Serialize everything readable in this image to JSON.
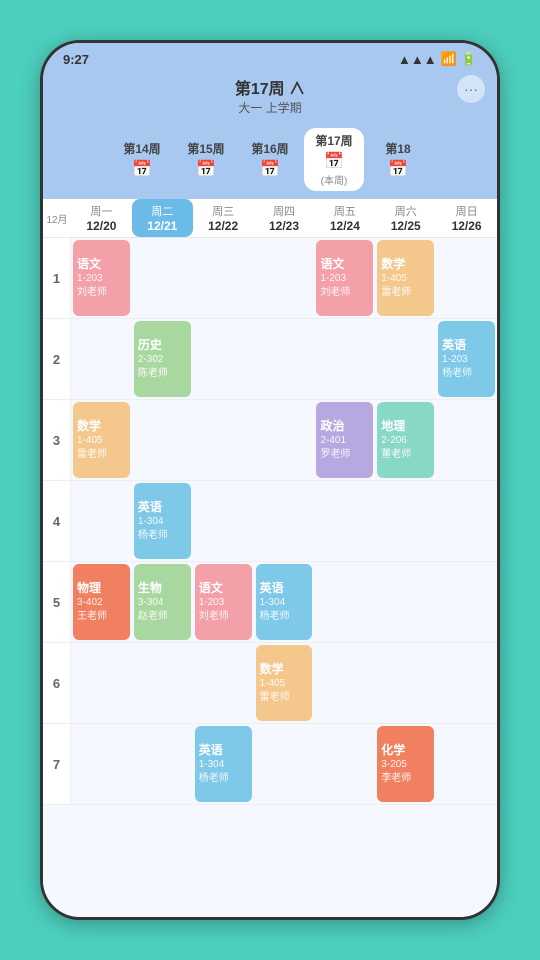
{
  "status": {
    "time": "9:27",
    "signal": "▲▲▲",
    "wifi": "WiFi",
    "battery": "■■"
  },
  "header": {
    "week_title": "第17周 ∧",
    "semester": "大一 上学期",
    "more_icon": "···"
  },
  "week_selector": [
    {
      "id": "w14",
      "label": "第14周",
      "active": false
    },
    {
      "id": "w15",
      "label": "第15周",
      "active": false
    },
    {
      "id": "w16",
      "label": "第16周",
      "active": false
    },
    {
      "id": "w17",
      "label": "第17周",
      "active": true,
      "current_label": "(本周)"
    },
    {
      "id": "w18",
      "label": "第18",
      "active": false
    }
  ],
  "days": [
    {
      "id": "mon",
      "name": "周一",
      "date": "12/20",
      "today": false
    },
    {
      "id": "tue",
      "name": "周二",
      "date": "12/21",
      "today": true
    },
    {
      "id": "wed",
      "name": "周三",
      "date": "12/22",
      "today": false
    },
    {
      "id": "thu",
      "name": "周四",
      "date": "12/23",
      "today": false
    },
    {
      "id": "fri",
      "name": "周五",
      "date": "12/24",
      "today": false
    },
    {
      "id": "sat",
      "name": "周六",
      "date": "12/25",
      "today": false
    },
    {
      "id": "sun",
      "name": "周日",
      "date": "12/26",
      "today": false
    }
  ],
  "month_label": "12月",
  "periods": [
    {
      "id": 1,
      "label": "1",
      "cells": [
        {
          "day": "mon",
          "course": "语文",
          "room": "1-203",
          "teacher": "刘老师",
          "color": "pink"
        },
        {
          "day": "tue",
          "course": "",
          "room": "",
          "teacher": "",
          "color": ""
        },
        {
          "day": "wed",
          "course": "",
          "room": "",
          "teacher": "",
          "color": ""
        },
        {
          "day": "thu",
          "course": "",
          "room": "",
          "teacher": "",
          "color": ""
        },
        {
          "day": "fri",
          "course": "语文",
          "room": "1-203",
          "teacher": "刘老师",
          "color": "pink"
        },
        {
          "day": "sat",
          "course": "数学",
          "room": "1-405",
          "teacher": "雷老师",
          "color": "orange"
        },
        {
          "day": "sun",
          "course": "",
          "room": "",
          "teacher": "",
          "color": ""
        }
      ]
    },
    {
      "id": 2,
      "label": "2",
      "cells": [
        {
          "day": "mon",
          "course": "",
          "room": "",
          "teacher": "",
          "color": ""
        },
        {
          "day": "tue",
          "course": "历史",
          "room": "2-302",
          "teacher": "陈老师",
          "color": "green"
        },
        {
          "day": "wed",
          "course": "",
          "room": "",
          "teacher": "",
          "color": ""
        },
        {
          "day": "thu",
          "course": "",
          "room": "",
          "teacher": "",
          "color": ""
        },
        {
          "day": "fri",
          "course": "",
          "room": "",
          "teacher": "",
          "color": ""
        },
        {
          "day": "sat",
          "course": "",
          "room": "",
          "teacher": "",
          "color": ""
        },
        {
          "day": "sun",
          "course": "英语",
          "room": "1-203",
          "teacher": "杨老师",
          "color": "blue"
        }
      ]
    },
    {
      "id": 3,
      "label": "3",
      "cells": [
        {
          "day": "mon",
          "course": "数学",
          "room": "1-405",
          "teacher": "雷老师",
          "color": "orange"
        },
        {
          "day": "tue",
          "course": "",
          "room": "",
          "teacher": "",
          "color": ""
        },
        {
          "day": "wed",
          "course": "",
          "room": "",
          "teacher": "",
          "color": ""
        },
        {
          "day": "thu",
          "course": "",
          "room": "",
          "teacher": "",
          "color": ""
        },
        {
          "day": "fri",
          "course": "政治",
          "room": "2-401",
          "teacher": "罗老师",
          "color": "purple"
        },
        {
          "day": "sat",
          "course": "地理",
          "room": "2-206",
          "teacher": "董老师",
          "color": "teal"
        },
        {
          "day": "sun",
          "course": "",
          "room": "",
          "teacher": "",
          "color": ""
        }
      ]
    },
    {
      "id": 4,
      "label": "4",
      "cells": [
        {
          "day": "mon",
          "course": "",
          "room": "",
          "teacher": "",
          "color": ""
        },
        {
          "day": "tue",
          "course": "英语",
          "room": "1-304",
          "teacher": "杨老师",
          "color": "blue"
        },
        {
          "day": "wed",
          "course": "",
          "room": "",
          "teacher": "",
          "color": ""
        },
        {
          "day": "thu",
          "course": "",
          "room": "",
          "teacher": "",
          "color": ""
        },
        {
          "day": "fri",
          "course": "",
          "room": "",
          "teacher": "",
          "color": ""
        },
        {
          "day": "sat",
          "course": "",
          "room": "",
          "teacher": "",
          "color": ""
        },
        {
          "day": "sun",
          "course": "",
          "room": "",
          "teacher": "",
          "color": ""
        }
      ]
    },
    {
      "id": 5,
      "label": "5",
      "cells": [
        {
          "day": "mon",
          "course": "物理",
          "room": "3-402",
          "teacher": "王老师",
          "color": "red-orange"
        },
        {
          "day": "tue",
          "course": "生物",
          "room": "3-304",
          "teacher": "赵老师",
          "color": "green"
        },
        {
          "day": "wed",
          "course": "语文",
          "room": "1-203",
          "teacher": "刘老师",
          "color": "pink"
        },
        {
          "day": "thu",
          "course": "英语",
          "room": "1-304",
          "teacher": "杨老师",
          "color": "blue"
        },
        {
          "day": "fri",
          "course": "",
          "room": "",
          "teacher": "",
          "color": ""
        },
        {
          "day": "sat",
          "course": "",
          "room": "",
          "teacher": "",
          "color": ""
        },
        {
          "day": "sun",
          "course": "",
          "room": "",
          "teacher": "",
          "color": ""
        }
      ]
    },
    {
      "id": 6,
      "label": "6",
      "cells": [
        {
          "day": "mon",
          "course": "",
          "room": "",
          "teacher": "",
          "color": ""
        },
        {
          "day": "tue",
          "course": "",
          "room": "",
          "teacher": "",
          "color": ""
        },
        {
          "day": "wed",
          "course": "",
          "room": "",
          "teacher": "",
          "color": ""
        },
        {
          "day": "thu",
          "course": "数学",
          "room": "1-405",
          "teacher": "雷老师",
          "color": "orange"
        },
        {
          "day": "fri",
          "course": "",
          "room": "",
          "teacher": "",
          "color": ""
        },
        {
          "day": "sat",
          "course": "",
          "room": "",
          "teacher": "",
          "color": ""
        },
        {
          "day": "sun",
          "course": "",
          "room": "",
          "teacher": "",
          "color": ""
        }
      ]
    },
    {
      "id": 7,
      "label": "7",
      "cells": [
        {
          "day": "mon",
          "course": "",
          "room": "",
          "teacher": "",
          "color": ""
        },
        {
          "day": "tue",
          "course": "",
          "room": "",
          "teacher": "",
          "color": ""
        },
        {
          "day": "wed",
          "course": "英语",
          "room": "1-304",
          "teacher": "杨老师",
          "color": "blue"
        },
        {
          "day": "thu",
          "course": "",
          "room": "",
          "teacher": "",
          "color": ""
        },
        {
          "day": "fri",
          "course": "",
          "room": "",
          "teacher": "",
          "color": ""
        },
        {
          "day": "sat",
          "course": "化学",
          "room": "3-205",
          "teacher": "李老师",
          "color": "red-orange"
        },
        {
          "day": "sun",
          "course": "",
          "room": "",
          "teacher": "",
          "color": ""
        }
      ]
    }
  ]
}
